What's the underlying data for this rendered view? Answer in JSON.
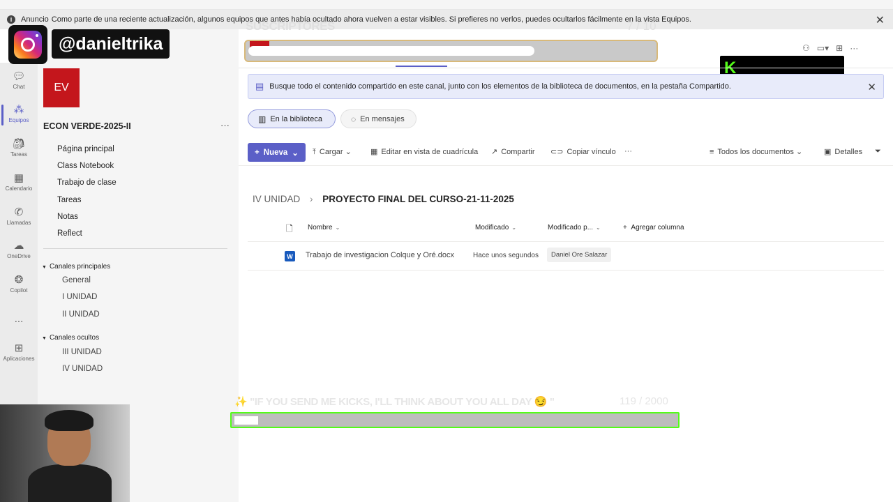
{
  "announcement": {
    "lead": "Anuncio",
    "text": "Como parte de una reciente actualización, algunos equipos que antes había ocultado ahora vuelven a estar visibles. Si prefieres no verlos, puedes ocultarlos fácilmente en la vista Equipos."
  },
  "rail": {
    "items": [
      {
        "label": "Chat",
        "icon": "chat-icon"
      },
      {
        "label": "Equipos",
        "icon": "teams-icon"
      },
      {
        "label": "Tareas",
        "icon": "tasks-icon"
      },
      {
        "label": "Calendario",
        "icon": "calendar-icon"
      },
      {
        "label": "Llamadas",
        "icon": "phone-icon"
      },
      {
        "label": "OneDrive",
        "icon": "cloud-icon"
      },
      {
        "label": "Copilot",
        "icon": "copilot-icon"
      },
      {
        "label": "...",
        "icon": "more-icon"
      },
      {
        "label": "Aplicaciones",
        "icon": "apps-icon"
      }
    ]
  },
  "team": {
    "initials": "EV",
    "name": "ECON VERDE-2025-II",
    "more": "···",
    "nav": [
      "Página principal",
      "Class Notebook",
      "Trabajo de clase",
      "Tareas",
      "Notas",
      "Reflect"
    ],
    "sections": [
      {
        "title": "Canales principales",
        "channels": [
          "General",
          "I UNIDAD",
          "II UNIDAD"
        ]
      },
      {
        "title": "Canales ocultos",
        "channels": [
          "III UNIDAD",
          "IV UNIDAD"
        ]
      }
    ]
  },
  "banner": {
    "text": "Busque todo el contenido compartido en este canal, junto con los elementos de la biblioteca de documentos, en la pestaña Compartido."
  },
  "pills": {
    "library": "En la biblioteca",
    "messages": "En mensajes"
  },
  "toolbar": {
    "new": "Nueva",
    "upload": "Cargar",
    "grid_edit": "Editar en vista de cuadrícula",
    "share": "Compartir",
    "copy_link": "Copiar vínculo",
    "more": "···",
    "view": "Todos los documentos",
    "details": "Detalles"
  },
  "breadcrumb": {
    "parent": "IV UNIDAD",
    "separator": "›",
    "current": "PROYECTO FINAL DEL CURSO-21-11-2025"
  },
  "table": {
    "columns": {
      "name": "Nombre",
      "modified": "Modificado",
      "modified_by": "Modificado p...",
      "add": "Agregar columna"
    },
    "rows": [
      {
        "name": "Trabajo de investigacion Colque y Oré.docx",
        "modified": "Hace unos segundos",
        "modified_by": "Daniel Ore Salazar"
      }
    ]
  },
  "overlays": {
    "instagram_handle": "@danieltrika",
    "subs_label": "SUSCRIPTORES",
    "subs_count": "7 / 10",
    "kick_message": "\"IF YOU SEND ME KICKS, I'LL THINK ABOUT YOU ALL DAY",
    "kick_message_end": "\"",
    "kick_count": "119 / 2000",
    "kick_letter": "K"
  },
  "colors": {
    "accent": "#5b5fc7",
    "team_red": "#c4161c",
    "kick_green": "#53fc18"
  }
}
